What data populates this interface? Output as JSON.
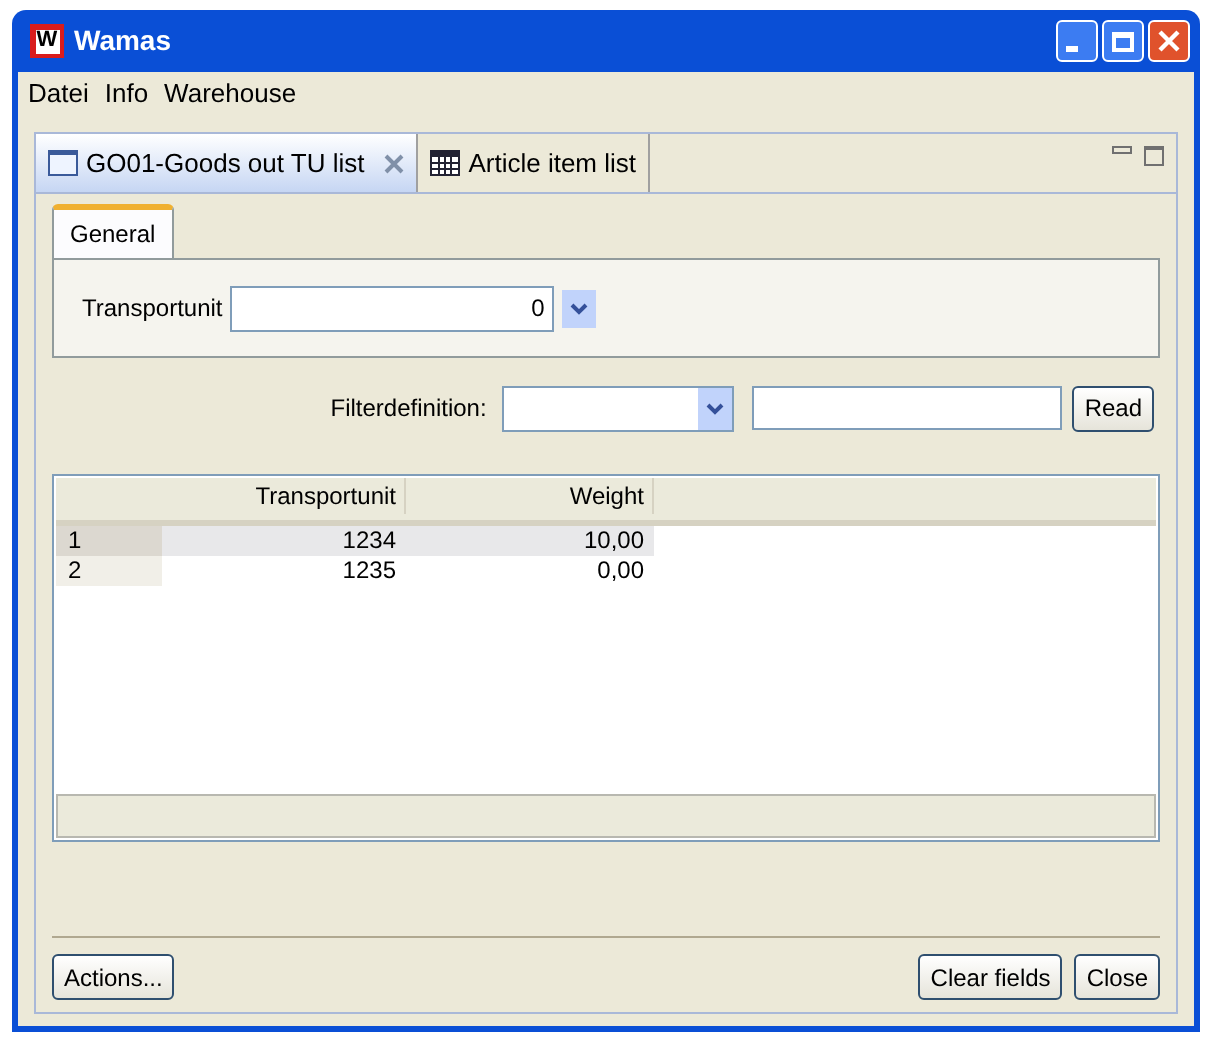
{
  "window": {
    "title": "Wamas",
    "logo": "W"
  },
  "menu": [
    "Datei",
    "Info",
    "Warehouse"
  ],
  "tabs": [
    {
      "label": "GO01-Goods out TU list",
      "selected": true,
      "kind": "form"
    },
    {
      "label": "Article item list",
      "selected": false,
      "kind": "table"
    }
  ],
  "subtabs": [
    {
      "label": "General",
      "selected": true
    }
  ],
  "transportunit": {
    "label": "Transportunit",
    "value": "0"
  },
  "filter": {
    "label": "Filterdefinition:",
    "button": "Read"
  },
  "table": {
    "columns": [
      "Transportunit",
      "Weight"
    ],
    "rows": [
      {
        "index": "1",
        "cells": [
          "1234",
          "10,00"
        ],
        "selected": true
      },
      {
        "index": "2",
        "cells": [
          "1235",
          "0,00"
        ],
        "selected": false
      }
    ]
  },
  "buttons_left": [
    "Actions..."
  ],
  "buttons_right": [
    "Clear fields",
    "Close"
  ]
}
